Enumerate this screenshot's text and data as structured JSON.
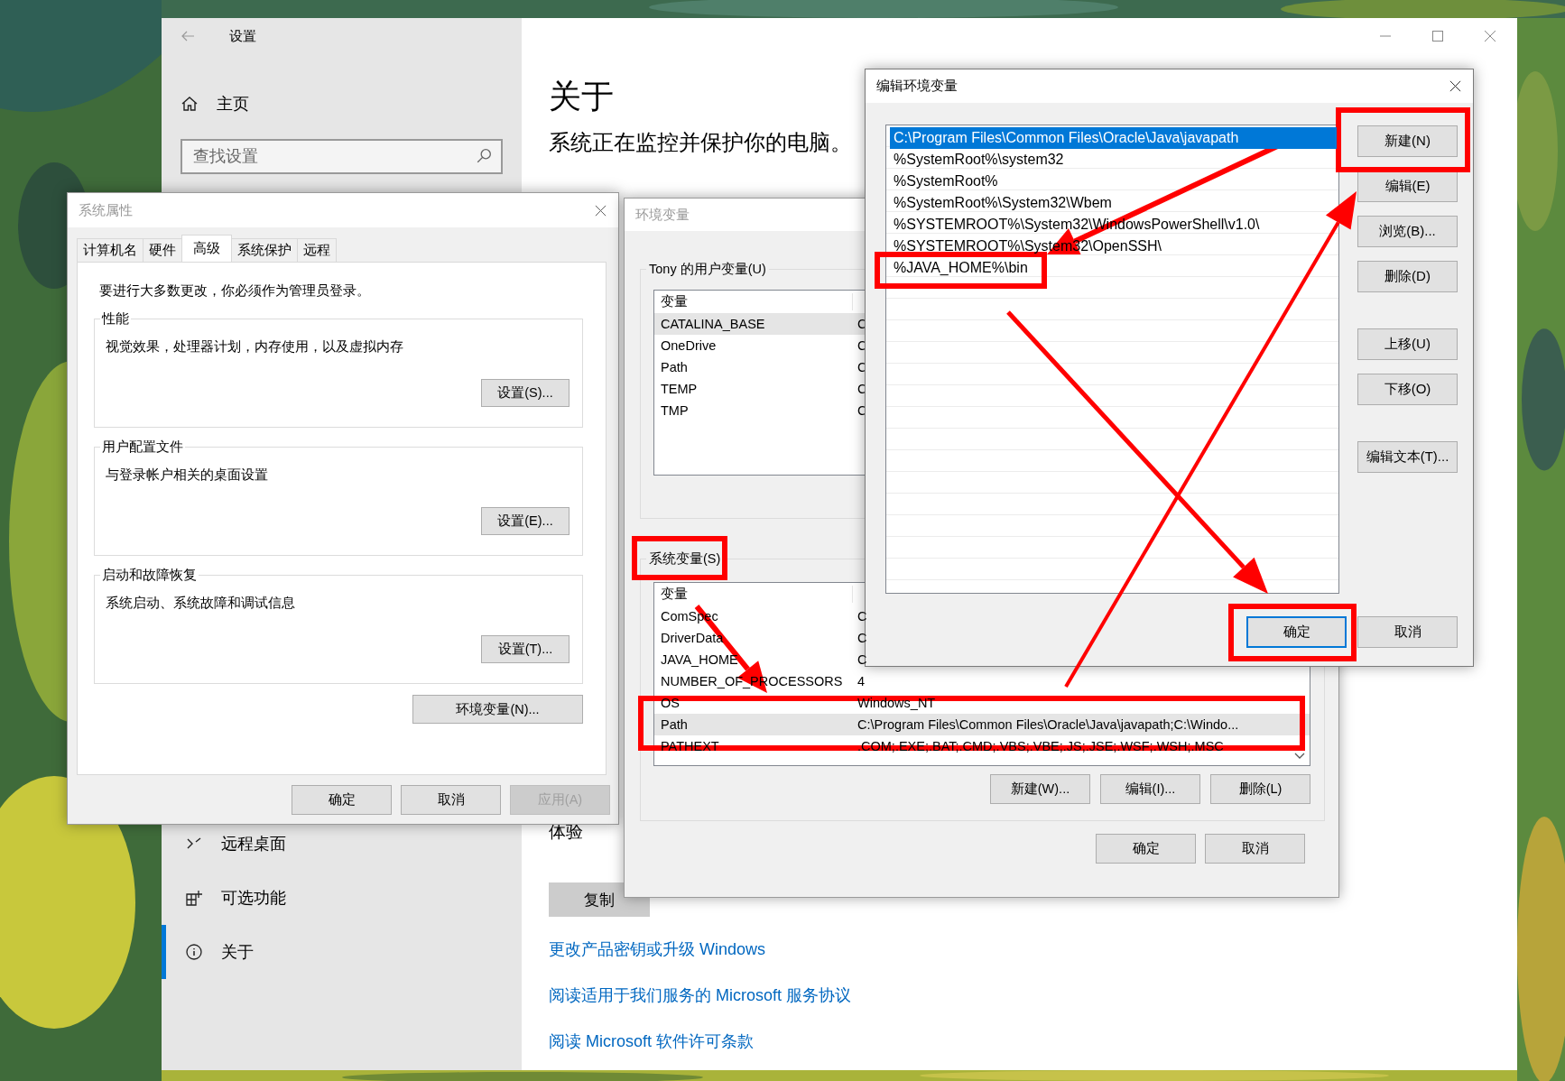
{
  "settings": {
    "title": "设置",
    "home": "主页",
    "search": {
      "placeholder": "查找设置"
    },
    "items": [
      {
        "label": "远程桌面",
        "selected": false
      },
      {
        "label": "可选功能",
        "selected": false
      },
      {
        "label": "关于",
        "selected": true
      }
    ],
    "heading": "关于",
    "subtitle": "系统正在监控并保护你的电脑。",
    "experience": "体验",
    "copy_button": "复制",
    "links": [
      "更改产品密钥或升级 Windows",
      "阅读适用于我们服务的 Microsoft 服务协议",
      "阅读 Microsoft 软件许可条款"
    ]
  },
  "system_properties": {
    "title": "系统属性",
    "tabs": [
      {
        "label": "计算机名",
        "selected": false
      },
      {
        "label": "硬件",
        "selected": false
      },
      {
        "label": "高级",
        "selected": true
      },
      {
        "label": "系统保护",
        "selected": false
      },
      {
        "label": "远程",
        "selected": false
      }
    ],
    "notice": "要进行大多数更改，你必须作为管理员登录。",
    "groups": [
      {
        "title": "性能",
        "description": "视觉效果，处理器计划，内存使用，以及虚拟内存",
        "button": "设置(S)..."
      },
      {
        "title": "用户配置文件",
        "description": "与登录帐户相关的桌面设置",
        "button": "设置(E)..."
      },
      {
        "title": "启动和故障恢复",
        "description": "系统启动、系统故障和调试信息",
        "button": "设置(T)..."
      }
    ],
    "env_button": "环境变量(N)...",
    "buttons": [
      {
        "label": "确定",
        "disabled": false
      },
      {
        "label": "取消",
        "disabled": false
      },
      {
        "label": "应用(A)",
        "disabled": true
      }
    ]
  },
  "environment_variables": {
    "title": "环境变量",
    "user_variables": {
      "label": "Tony 的用户变量(U)",
      "columns": [
        "变量"
      ],
      "rows": [
        {
          "name": "CATALINA_BASE",
          "value": "C",
          "selected": true
        },
        {
          "name": "OneDrive",
          "value": "C",
          "selected": false
        },
        {
          "name": "Path",
          "value": "C",
          "selected": false
        },
        {
          "name": "TEMP",
          "value": "C",
          "selected": false
        },
        {
          "name": "TMP",
          "value": "C",
          "selected": false
        }
      ]
    },
    "system_variables": {
      "label": "系统变量(S)",
      "columns": [
        "变量"
      ],
      "rows": [
        {
          "name": "ComSpec",
          "value": "C",
          "selected": false
        },
        {
          "name": "DriverData",
          "value": "C",
          "selected": false
        },
        {
          "name": "JAVA_HOME",
          "value": "C",
          "selected": false
        },
        {
          "name": "NUMBER_OF_PROCESSORS",
          "value": "4",
          "selected": false
        },
        {
          "name": "OS",
          "value": "Windows_NT",
          "selected": false
        },
        {
          "name": "Path",
          "value": "C:\\Program Files\\Common Files\\Oracle\\Java\\javapath;C:\\Windo...",
          "selected": true
        },
        {
          "name": "PATHEXT",
          "value": ".COM;.EXE;.BAT;.CMD;.VBS;.VBE;.JS;.JSE;.WSF;.WSH;.MSC",
          "selected": false
        }
      ],
      "buttons": [
        "新建(W)...",
        "编辑(I)...",
        "删除(L)"
      ]
    },
    "buttons": [
      "确定",
      "取消"
    ]
  },
  "edit_variable": {
    "title": "编辑环境变量",
    "entries": [
      {
        "text": "C:\\Program Files\\Common Files\\Oracle\\Java\\javapath",
        "selected": true
      },
      {
        "text": "%SystemRoot%\\system32",
        "selected": false
      },
      {
        "text": "%SystemRoot%",
        "selected": false
      },
      {
        "text": "%SystemRoot%\\System32\\Wbem",
        "selected": false
      },
      {
        "text": "%SYSTEMROOT%\\System32\\WindowsPowerShell\\v1.0\\",
        "selected": false
      },
      {
        "text": "%SYSTEMROOT%\\System32\\OpenSSH\\",
        "selected": false
      },
      {
        "text": "%JAVA_HOME%\\bin",
        "selected": false
      }
    ],
    "side_buttons": [
      "新建(N)",
      "编辑(E)",
      "浏览(B)...",
      "删除(D)",
      "上移(U)",
      "下移(O)",
      "编辑文本(T)..."
    ],
    "buttons": [
      {
        "label": "确定",
        "default": true
      },
      {
        "label": "取消",
        "default": false
      }
    ]
  }
}
